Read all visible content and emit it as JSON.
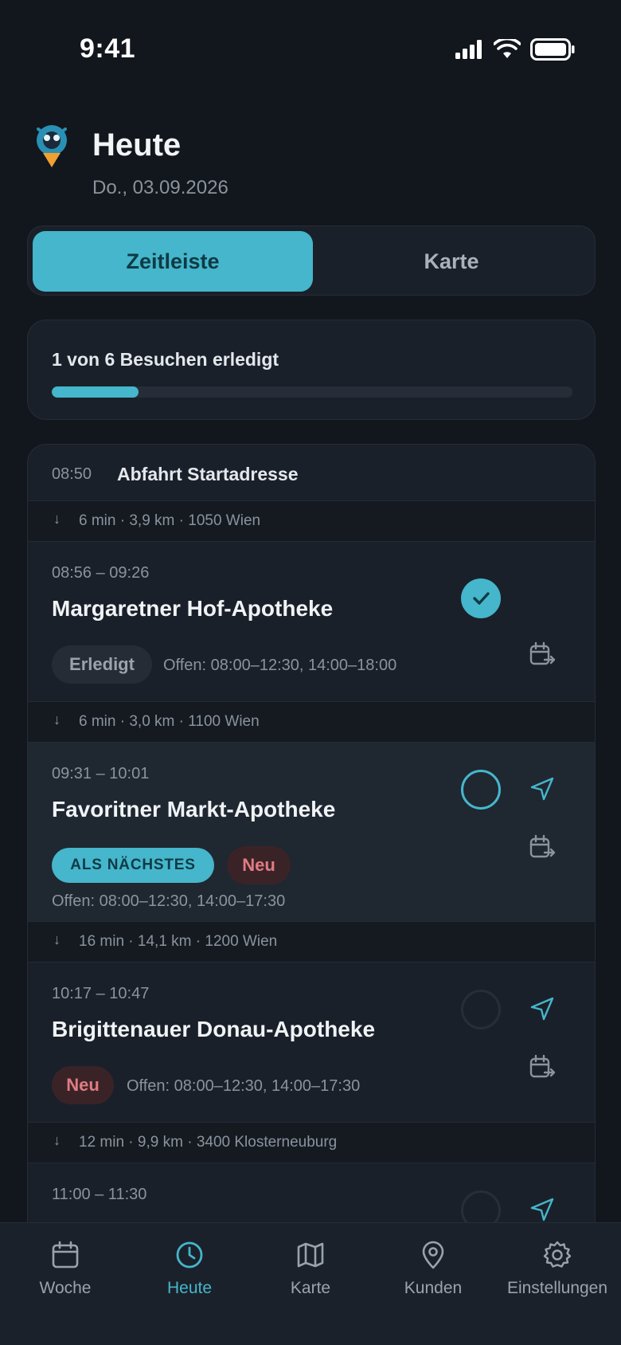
{
  "status_bar": {
    "time": "9:41"
  },
  "header": {
    "title": "Heute",
    "date": "Do., 03.09.2026"
  },
  "segmented": {
    "active_label": "Zeitleiste",
    "inactive_label": "Karte"
  },
  "progress": {
    "label": "1 von 6 Besuchen erledigt",
    "completed": 1,
    "total": 6
  },
  "timeline": {
    "start": {
      "time": "08:50",
      "label": "Abfahrt Startadresse"
    },
    "travel": [
      {
        "arrow": "↓",
        "text": "6 min · 3,9 km · 1050 Wien"
      },
      {
        "arrow": "↓",
        "text": "6 min · 3,0 km · 1100 Wien"
      },
      {
        "arrow": "↓",
        "text": "16 min · 14,1 km · 1200 Wien"
      },
      {
        "arrow": "↓",
        "text": "12 min · 9,9 km · 3400 Klosterneuburg"
      }
    ],
    "visits": [
      {
        "time": "08:56 – 09:26",
        "name": "Margaretner Hof-Apotheke",
        "status_pill": "Erledigt",
        "hours": "Offen: 08:00–12:30, 14:00–18:00",
        "state": "done"
      },
      {
        "time": "09:31 – 10:01",
        "name": "Favoritner Markt-Apotheke",
        "next_pill": "ALS NÄCHSTES",
        "new_pill": "Neu",
        "hours": "Offen: 08:00–12:30, 14:00–17:30",
        "state": "next"
      },
      {
        "time": "10:17 – 10:47",
        "name": "Brigittenauer Donau-Apotheke",
        "new_pill": "Neu",
        "hours": "Offen: 08:00–12:30, 14:00–17:30",
        "state": "open"
      },
      {
        "time": "11:00 – 11:30",
        "state": "open"
      }
    ]
  },
  "tabs": [
    {
      "label": "Woche",
      "icon": "calendar-icon"
    },
    {
      "label": "Heute",
      "icon": "clock-icon",
      "active": true
    },
    {
      "label": "Karte",
      "icon": "map-icon"
    },
    {
      "label": "Kunden",
      "icon": "location-pin-icon"
    },
    {
      "label": "Einstellungen",
      "icon": "gear-icon"
    }
  ],
  "colors": {
    "accent": "#45b6cb",
    "background": "#12161d",
    "card": "#1a2029",
    "new_badge_text": "#e07b83"
  }
}
